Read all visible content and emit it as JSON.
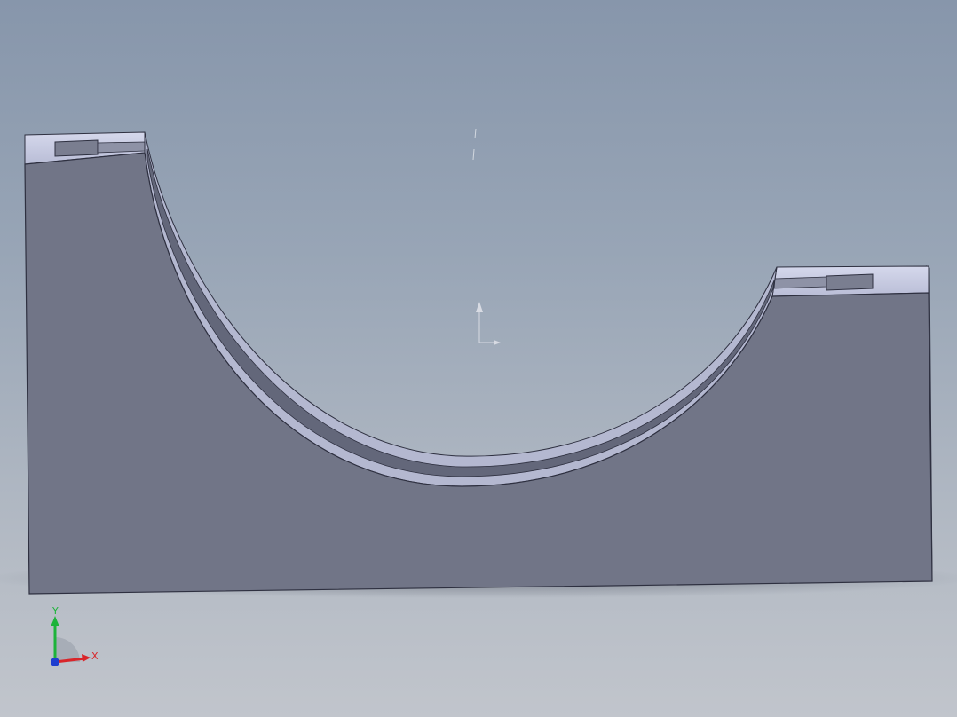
{
  "app": {
    "view": "graphics-area"
  },
  "model": {
    "face_color": "#717587",
    "top_face_color": "#c9cde3",
    "edge_color": "#2e3040",
    "channel_color": "#63677a"
  },
  "triad": {
    "x_label": "X",
    "y_label": "Y",
    "x_color": "#d9252a",
    "y_color": "#1db33a",
    "z_color": "#1f3fd0"
  },
  "origin_marker": {
    "icon": "origin-arrow-icon"
  }
}
